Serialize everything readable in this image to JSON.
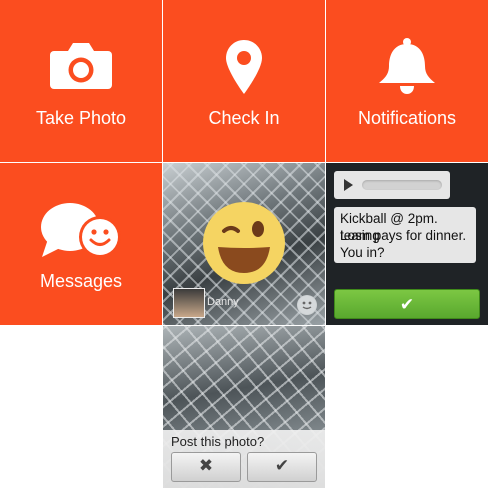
{
  "tiles": {
    "take_photo": {
      "label": "Take Photo",
      "icon": "camera-icon"
    },
    "check_in": {
      "label": "Check In",
      "icon": "location-pin-icon"
    },
    "notifications": {
      "label": "Notifications",
      "icon": "bell-icon"
    },
    "messages": {
      "label": "Messages",
      "icon": "chat-bubbles-icon"
    }
  },
  "friend": {
    "name": "Danny",
    "reaction_icon": "winking-smiley-icon"
  },
  "message": {
    "text_line1": "Kickball @ 2pm. Losing",
    "text_line2": "team pays for dinner.",
    "text_line3": "You in?",
    "accept_glyph": "✔"
  },
  "post_photo": {
    "question": "Post this photo?",
    "reject_glyph": "✖",
    "accept_glyph": "✔"
  },
  "colors": {
    "tile_orange": "#fb4d1f",
    "accept_green": "#6bbb3a"
  }
}
